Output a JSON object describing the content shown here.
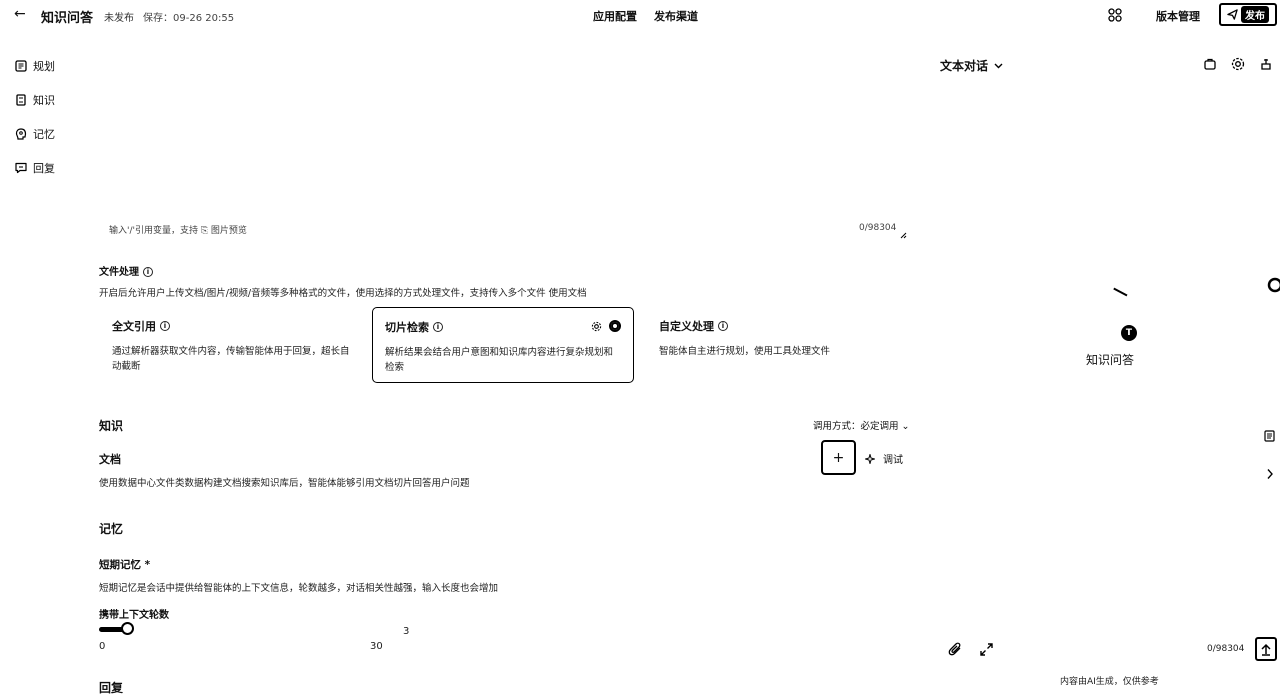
{
  "topbar": {
    "back": "←",
    "title": "知识问答",
    "status": "未发布",
    "saved": "保存：09-26 20:55",
    "tabs": [
      "应用配置",
      "发布渠道"
    ],
    "version_label": "版本管理",
    "publish_label": "发布"
  },
  "sidebar": {
    "items": [
      {
        "label": "规划",
        "icon": "plan-icon"
      },
      {
        "label": "知识",
        "icon": "knowledge-icon"
      },
      {
        "label": "记忆",
        "icon": "memory-icon"
      },
      {
        "label": "回复",
        "icon": "reply-icon"
      }
    ]
  },
  "prompt": {
    "placeholder": "输入'/'引用变量，支持 ⎘ 图片预览",
    "count": "0/98304"
  },
  "file_processing": {
    "title": "文件处理",
    "desc": "开启后允许用户上传文档/图片/视频/音频等多种格式的文件，使用选择的方式处理文件，支持传入多个文件 使用文档",
    "cards": [
      {
        "title": "全文引用",
        "desc": "通过解析器获取文件内容，传输智能体用于回复，超长自动截断",
        "selected": false
      },
      {
        "title": "切片检索",
        "desc": "解析结果会结合用户意图和知识库内容进行复杂规划和检索",
        "selected": true
      },
      {
        "title": "自定义处理",
        "desc": "智能体自主进行规划，使用工具处理文件",
        "selected": false
      }
    ]
  },
  "knowledge": {
    "title": "知识",
    "call_mode": "调用方式：必定调用 ⌄",
    "doc_title": "文档",
    "doc_desc": "使用数据中心文件类数据构建文档搜索知识库后，智能体能够引用文档切片回答用户问题",
    "add": "+",
    "debug": "调试"
  },
  "memory": {
    "title": "记忆",
    "short_term_title": "短期记忆",
    "required_mark": "*",
    "short_term_desc": "短期记忆是会话中提供给智能体的上下文信息，轮数越多，对话相关性越强，输入长度也会增加",
    "rounds_label": "携带上下文轮数",
    "slider": {
      "value": 3,
      "min": 0,
      "max": 30
    },
    "min_label": "0",
    "max_label": "30",
    "value_label": "3"
  },
  "reply": {
    "title": "回复"
  },
  "preview": {
    "mode": "文本对话",
    "bot_initial": "T",
    "bot_name": "知识问答",
    "count": "0/98304",
    "ai_note": "内容由AI生成，仅供参考"
  }
}
